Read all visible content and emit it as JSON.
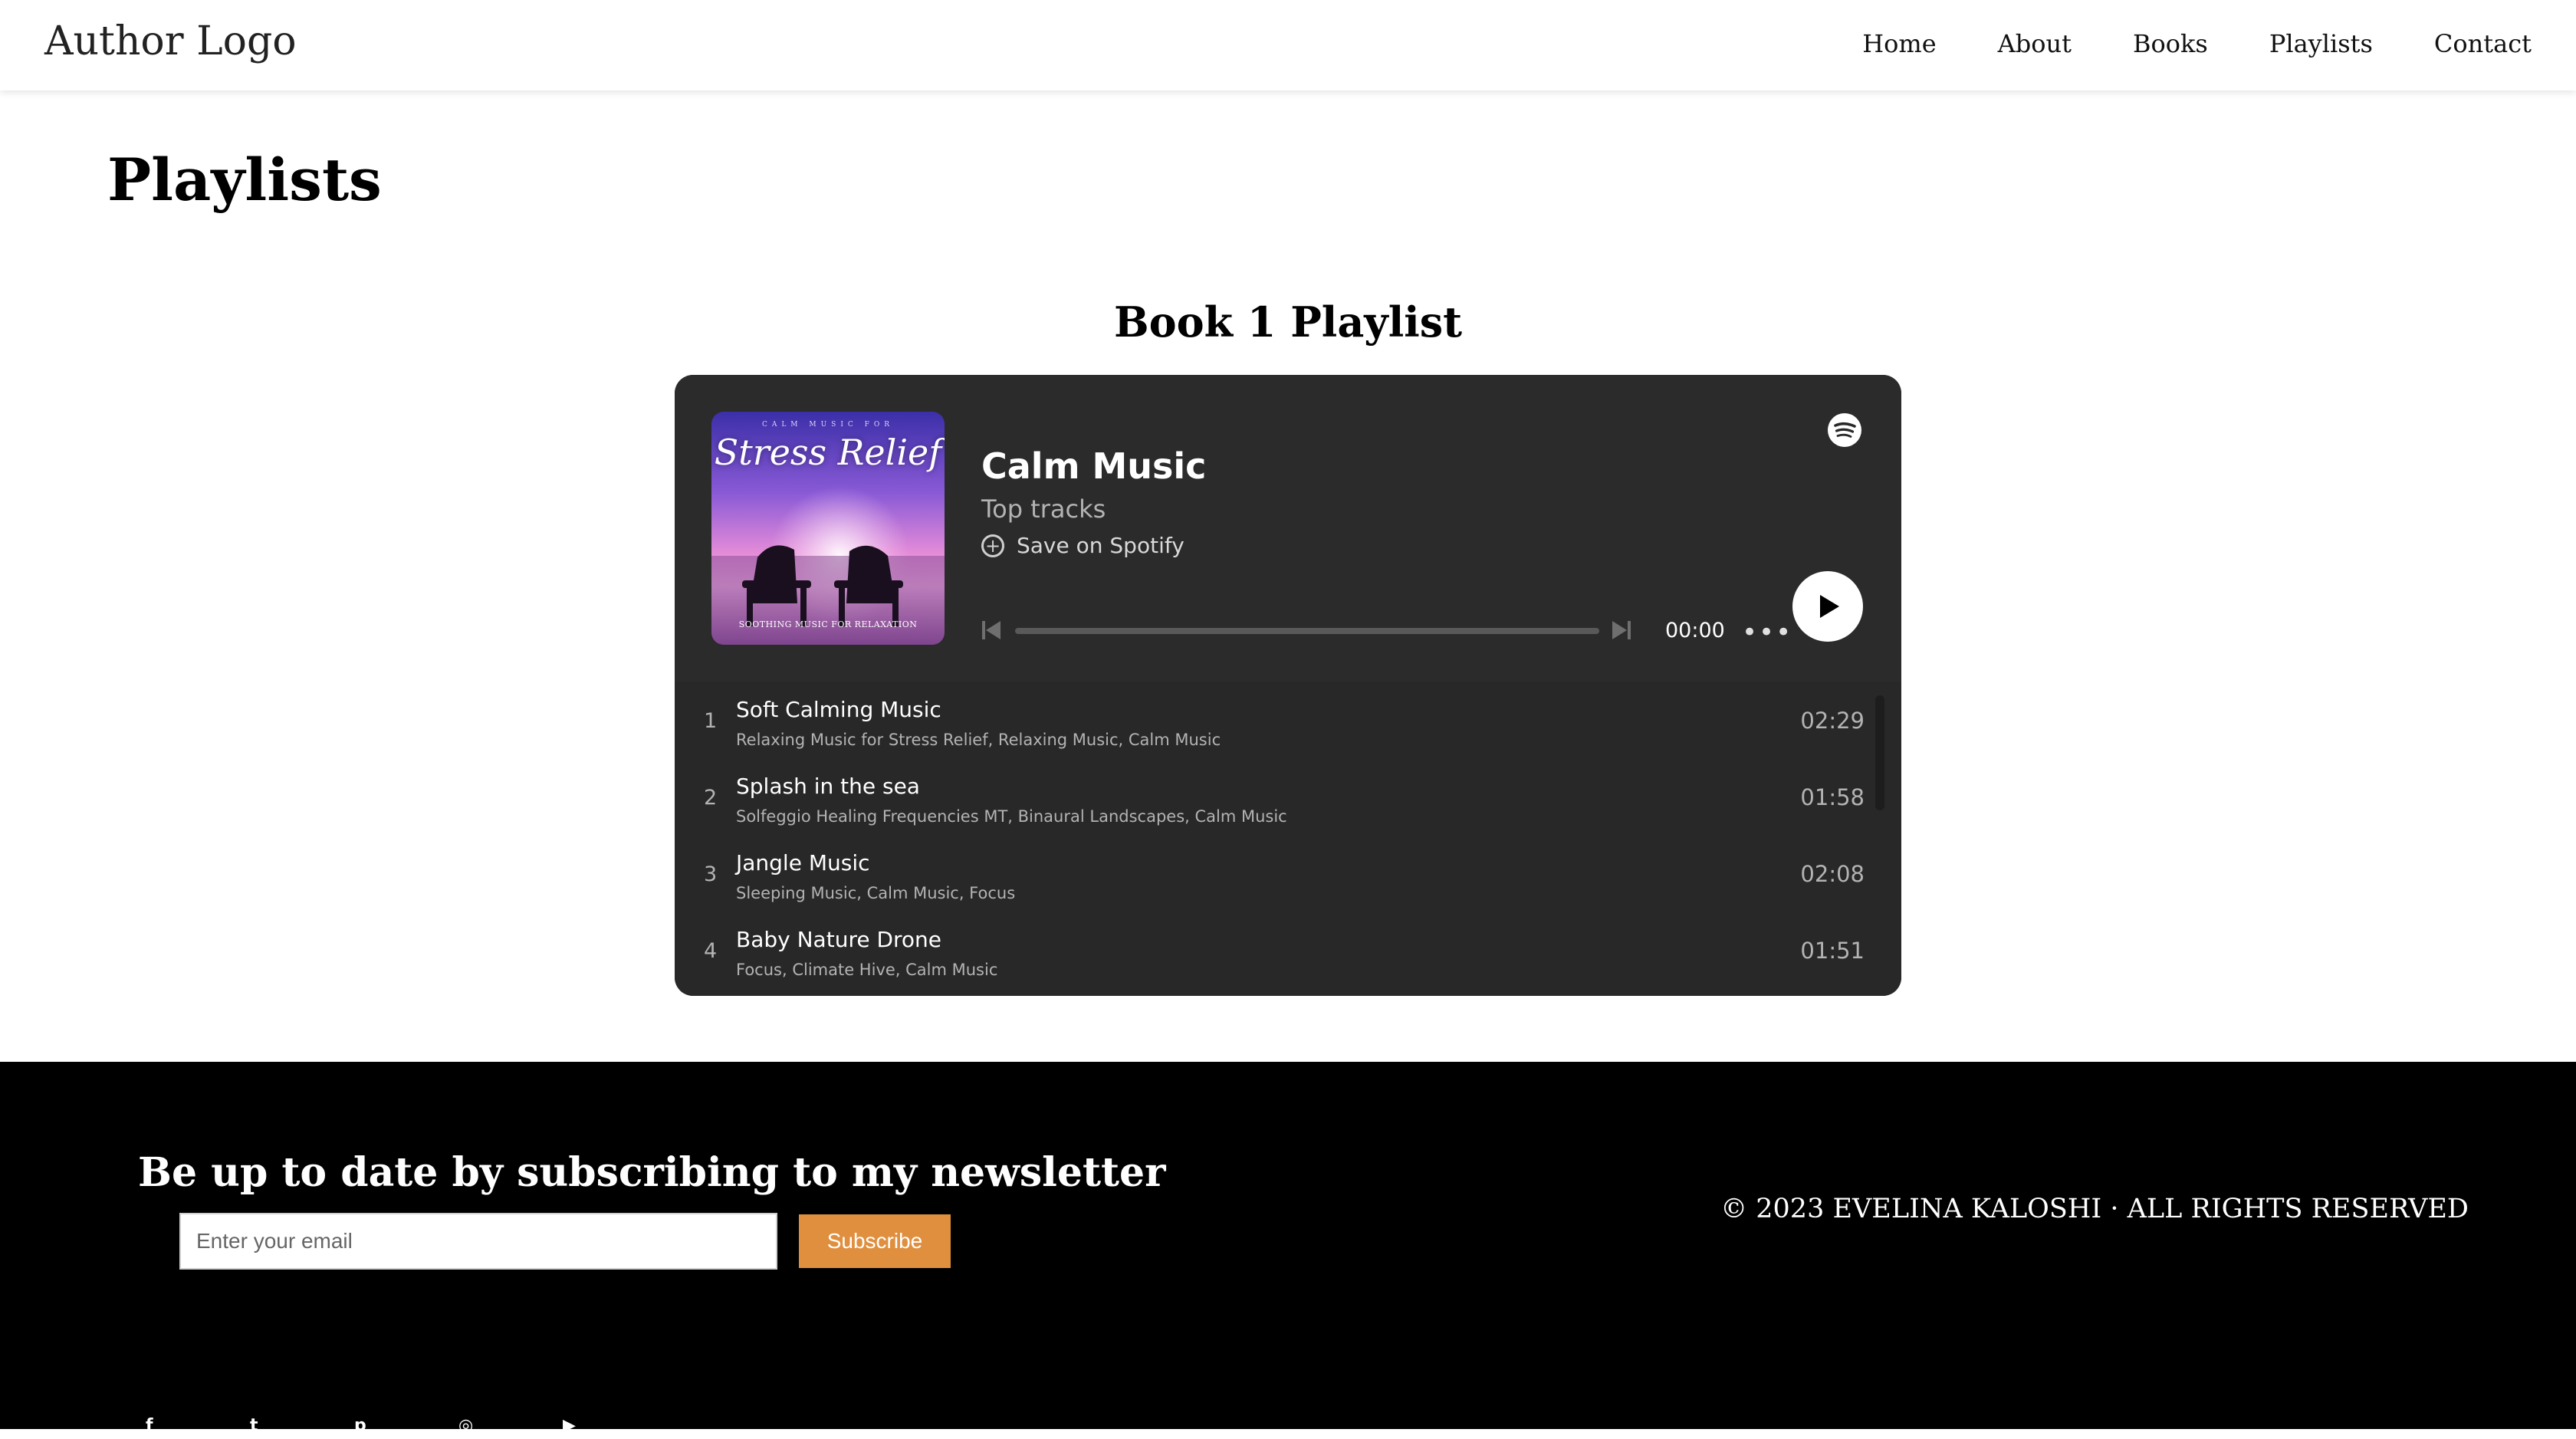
{
  "header": {
    "logo": "Author Logo",
    "nav": [
      "Home",
      "About",
      "Books",
      "Playlists",
      "Contact"
    ]
  },
  "page": {
    "title": "Playlists",
    "section_title": "Book 1 Playlist"
  },
  "player": {
    "cover": {
      "top_text": "CALM MUSIC FOR",
      "title": "Stress Relief",
      "caption": "SOOTHING MUSIC FOR RELAXATION"
    },
    "title": "Calm Music",
    "subtitle": "Top tracks",
    "save_label": "Save on Spotify",
    "time": "00:00",
    "progress": 0,
    "tracks": [
      {
        "num": "1",
        "name": "Soft Calming Music",
        "artists": "Relaxing Music for Stress Relief, Relaxing Music, Calm Music",
        "duration": "02:29"
      },
      {
        "num": "2",
        "name": "Splash in the sea",
        "artists": "Solfeggio Healing Frequencies MT, Binaural Landscapes, Calm Music",
        "duration": "01:58"
      },
      {
        "num": "3",
        "name": "Jangle Music",
        "artists": "Sleeping Music, Calm Music, Focus",
        "duration": "02:08"
      },
      {
        "num": "4",
        "name": "Baby Nature Drone",
        "artists": "Focus, Climate Hive, Calm Music",
        "duration": "01:51"
      }
    ],
    "colors": {
      "background": "#282828",
      "accent": "#ffffff",
      "muted": "#b3b3b3"
    },
    "icons": [
      "spotify-icon",
      "plus-circle-icon",
      "skip-previous-icon",
      "skip-next-icon",
      "more-icon",
      "play-icon"
    ]
  },
  "footer": {
    "newsletter_title": "Be up to date by subscribing to my newsletter",
    "email_placeholder": "Enter your email",
    "subscribe_label": "Subscribe",
    "copyright": "© 2023 EVELINA KALOSHI · ALL RIGHTS RESERVED",
    "socials": [
      "facebook-icon",
      "twitter-icon",
      "pinterest-icon",
      "instagram-icon",
      "youtube-icon"
    ],
    "colors": {
      "background": "#000000",
      "button": "#e08f3e"
    }
  }
}
